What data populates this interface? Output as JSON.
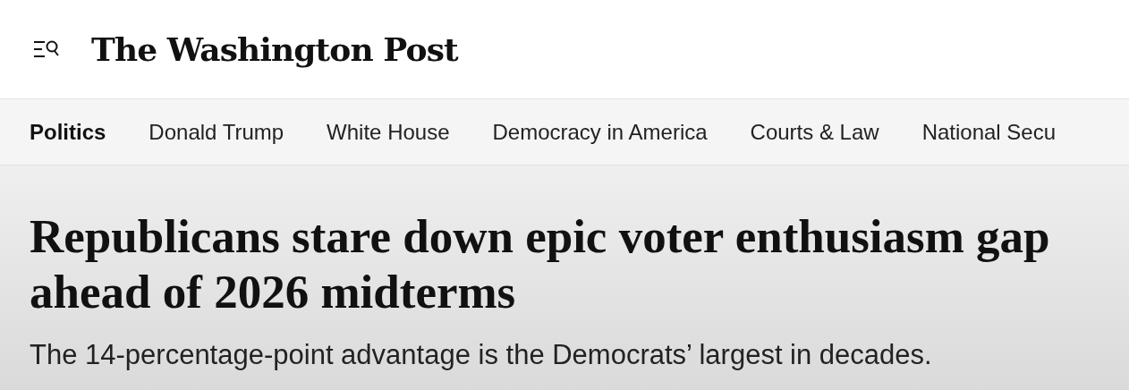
{
  "header": {
    "logo": "The Washington Post"
  },
  "nav": {
    "items": [
      {
        "label": "Politics",
        "selected": true
      },
      {
        "label": "Donald Trump",
        "selected": false
      },
      {
        "label": "White House",
        "selected": false
      },
      {
        "label": "Democracy in America",
        "selected": false
      },
      {
        "label": "Courts & Law",
        "selected": false
      },
      {
        "label": "National Secu",
        "selected": false
      }
    ]
  },
  "article": {
    "headline": "Republicans stare down epic voter enthusiasm gap ahead of 2026 midterms",
    "subheadline": "The 14-percentage-point advantage is the Democrats’ largest in decades."
  }
}
